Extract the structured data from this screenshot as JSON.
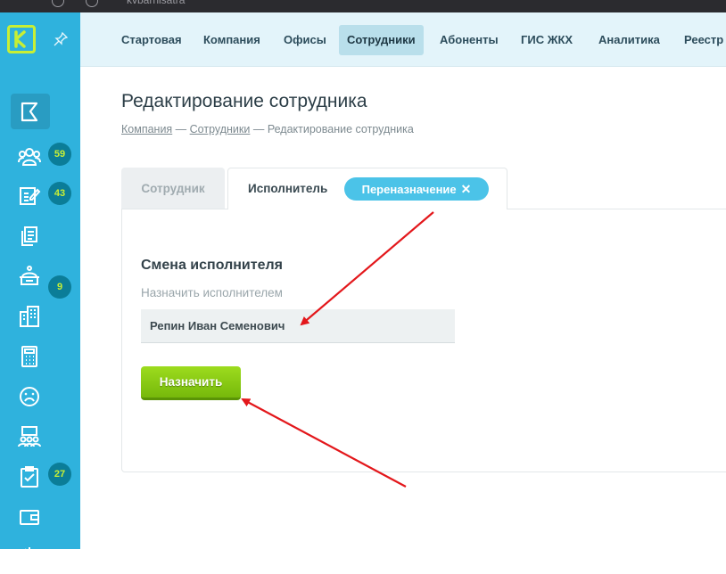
{
  "browser": {
    "url": "kvbarnisatra"
  },
  "sidebar": {
    "logo_text": "K",
    "items": [
      {
        "icon": "flag-icon",
        "badge": ""
      },
      {
        "icon": "users-icon",
        "badge": "59"
      },
      {
        "icon": "edit-icon",
        "badge": "43"
      },
      {
        "icon": "documents-icon",
        "badge": ""
      },
      {
        "icon": "service-bell-icon",
        "badge": "9"
      },
      {
        "icon": "building-icon",
        "badge": ""
      },
      {
        "icon": "calculator-icon",
        "badge": ""
      },
      {
        "icon": "sad-face-icon",
        "badge": ""
      },
      {
        "icon": "group-chat-icon",
        "badge": ""
      },
      {
        "icon": "clipboard-check-icon",
        "badge": "27"
      },
      {
        "icon": "wallet-icon",
        "badge": ""
      }
    ]
  },
  "topnav": {
    "items": [
      "Стартовая",
      "Компания",
      "Офисы",
      "Сотрудники",
      "Абоненты",
      "ГИС ЖКХ",
      "Аналитика",
      "Реестр"
    ],
    "active": "Сотрудники"
  },
  "page": {
    "title": "Редактирование сотрудника",
    "breadcrumb": {
      "company": "Компания",
      "sep1": " — ",
      "employees": "Сотрудники",
      "sep2": " — ",
      "current": "Редактирование сотрудника"
    }
  },
  "tabs": {
    "employee": "Сотрудник",
    "executor": "Исполнитель",
    "reassign_chip": "Переназначение",
    "reassign_close": "✕"
  },
  "form": {
    "section_title": "Смена исполнителя",
    "field_label": "Назначить исполнителем",
    "field_value": "Репин Иван Семенович",
    "submit_label": "Назначить"
  },
  "colors": {
    "sidebar": "#2fb2dd",
    "badge": "#0b7d98",
    "accent_green": "#8ccb14",
    "chip": "#4bc3e8",
    "annotation_arrow": "#e3171b"
  }
}
